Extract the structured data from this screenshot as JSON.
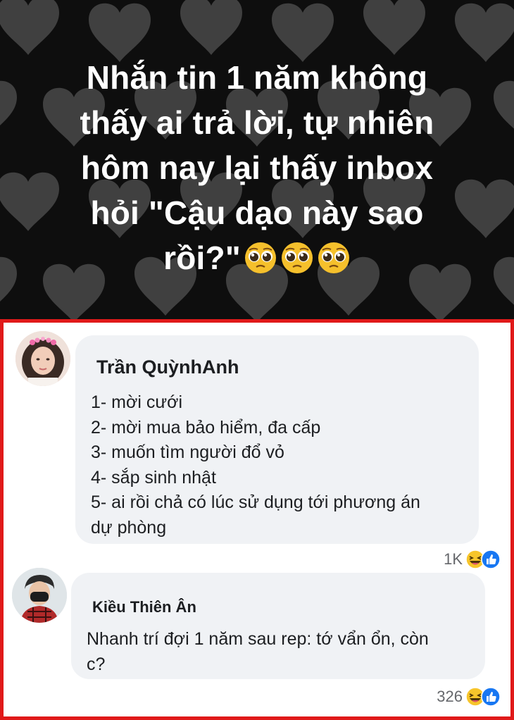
{
  "banner": {
    "lines": [
      "Nhắn tin 1 năm không",
      "thấy ai trả lời, tự nhiên",
      "hôm nay lại thấy inbox",
      "hỏi \"Cậu dạo này sao",
      "rồi?\""
    ],
    "emoji": [
      "pleading-face-icon",
      "pleading-face-icon",
      "pleading-face-icon"
    ],
    "colors": {
      "background": "#0e0e0e",
      "hearts": "#555555",
      "text": "#ffffff"
    }
  },
  "comments": [
    {
      "author": "Trần QuỳnhAnh",
      "lines": [
        "1- mời cưới",
        "2- mời mua bảo hiểm, đa cấp",
        "3- muốn tìm người đổ vỏ",
        "4- sắp sinh nhật",
        "5- ai rồi chả có lúc sử dụng tới phương án",
        "dự phòng"
      ],
      "reaction_count": "1K",
      "reactions": [
        "haha-icon",
        "like-icon"
      ]
    },
    {
      "author": "Kiều Thiên Ân",
      "lines": [
        "Nhanh trí đợi 1 năm sau rep: tớ vẩn ổn, còn",
        "c?"
      ],
      "reaction_count": "326",
      "reactions": [
        "haha-icon",
        "like-icon"
      ]
    }
  ],
  "frame_color": "#e01a1a",
  "bubble_color": "#f0f2f5"
}
